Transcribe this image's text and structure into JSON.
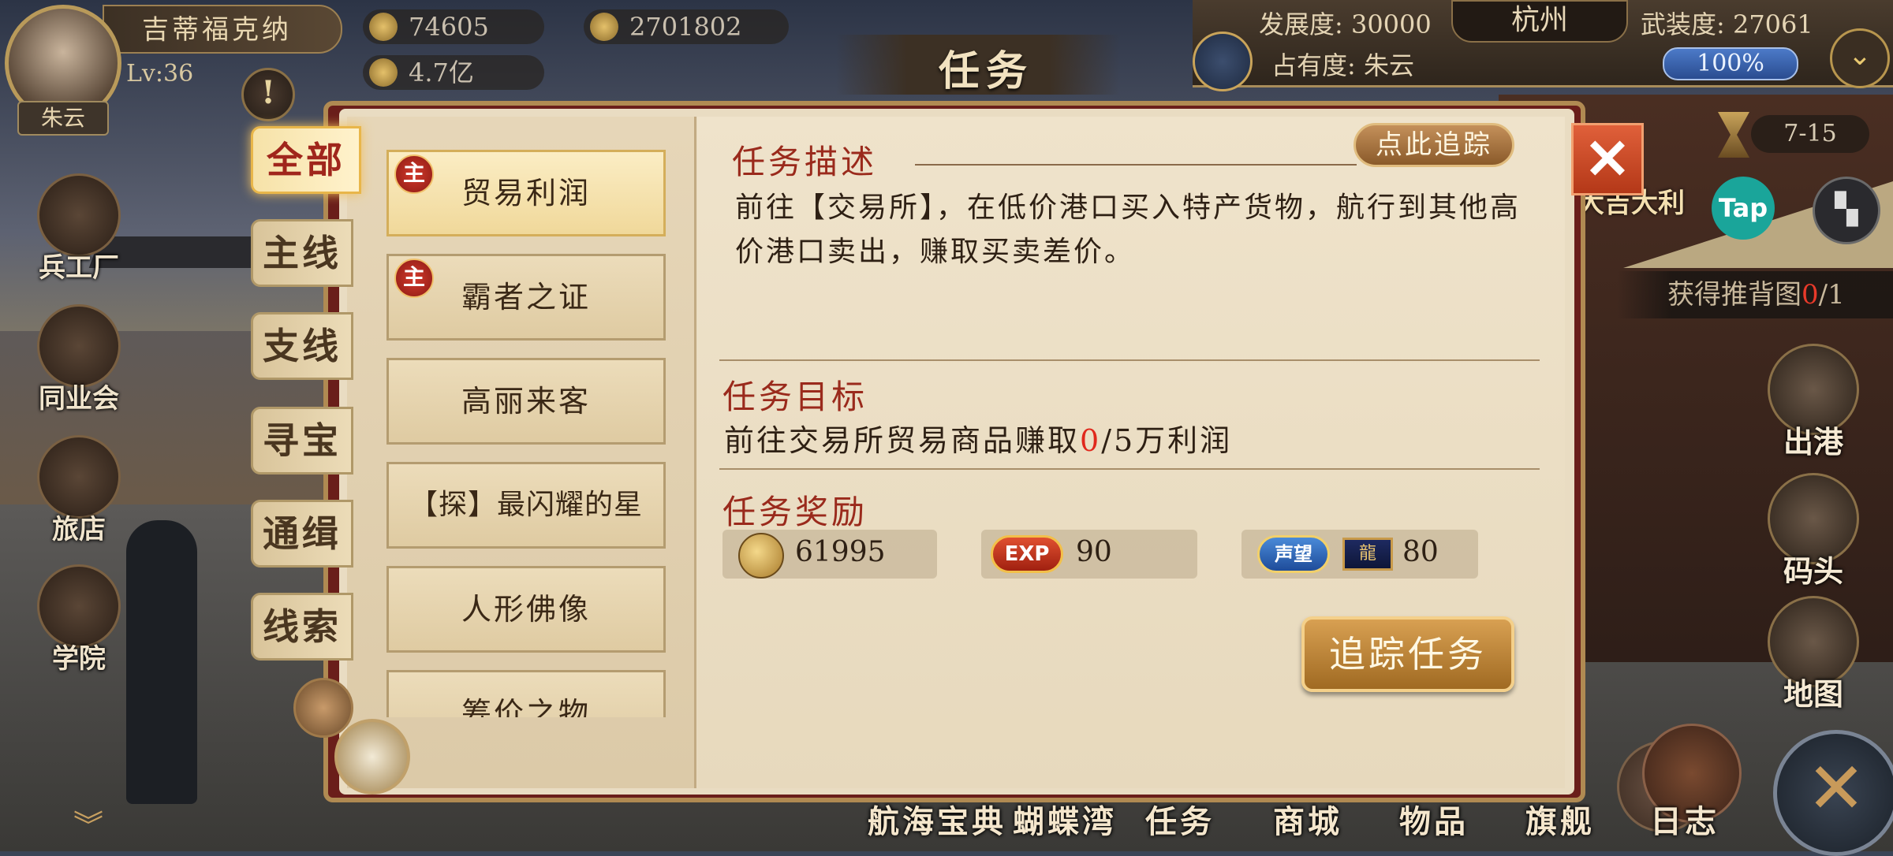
{
  "player": {
    "name": "吉蒂福克纳",
    "level": "Lv:36",
    "tag": "朱云"
  },
  "resources": {
    "swords": "74605",
    "handshake": "2701802",
    "coins": "4.7亿"
  },
  "city": {
    "development_label": "发展度: 30000",
    "name": "杭州",
    "armament_label": "武装度: 27061",
    "occupancy_label": "占有度: 朱云",
    "occupancy_pct": "100%"
  },
  "title": "任务",
  "left_menu": [
    {
      "label": "兵工厂",
      "icon": "cannon-icon"
    },
    {
      "label": "同业会",
      "icon": "anchor-shield-icon"
    },
    {
      "label": "旅店",
      "icon": "bed-icon"
    },
    {
      "label": "学院",
      "icon": "book-icon"
    }
  ],
  "right_top": {
    "timer": "7-15",
    "event_label": "大吉大利",
    "tap": "Tap",
    "treasure_prefix": "获得推背图",
    "treasure_count": "0",
    "treasure_total": "/1"
  },
  "right_menu": [
    {
      "label": "出港",
      "icon": "ship-icon"
    },
    {
      "label": "码头",
      "icon": "dock-icon"
    },
    {
      "label": "地图",
      "icon": "map-scroll-icon"
    }
  ],
  "bottom_menu": [
    "航海宝典",
    "蝴蝶湾",
    "任务",
    "商城",
    "物品",
    "旗舰",
    "日志"
  ],
  "tabs": [
    "全部",
    "主线",
    "支线",
    "寻宝",
    "通缉",
    "线索"
  ],
  "quests": [
    {
      "title": "贸易利润",
      "badge": "主"
    },
    {
      "title": "霸者之证",
      "badge": "主"
    },
    {
      "title": "高丽来客",
      "badge": ""
    },
    {
      "title": "【探】最闪耀的星",
      "badge": ""
    },
    {
      "title": "人形佛像",
      "badge": ""
    },
    {
      "title": "筹价之物",
      "badge": ""
    }
  ],
  "detail": {
    "desc_title": "任务描述",
    "track_here": "点此追踪",
    "desc_text": "前往【交易所】，在低价港口买入特产货物，航行到其他高价港口卖出，赚取买卖差价。",
    "goal_title": "任务目标",
    "goal_prefix": "前往交易所贸易商品赚取",
    "goal_progress": "0",
    "goal_suffix": "/5万利润",
    "reward_title": "任务奖励",
    "reward_coin": "61995",
    "exp_label": "EXP",
    "reward_exp": "90",
    "rep_label": "声望",
    "reward_rep": "80",
    "track_button": "追踪任务"
  },
  "colors": {
    "accent_red": "#9a2a1c",
    "progress_red": "#e0281c",
    "tab_active": "#a0261c"
  }
}
